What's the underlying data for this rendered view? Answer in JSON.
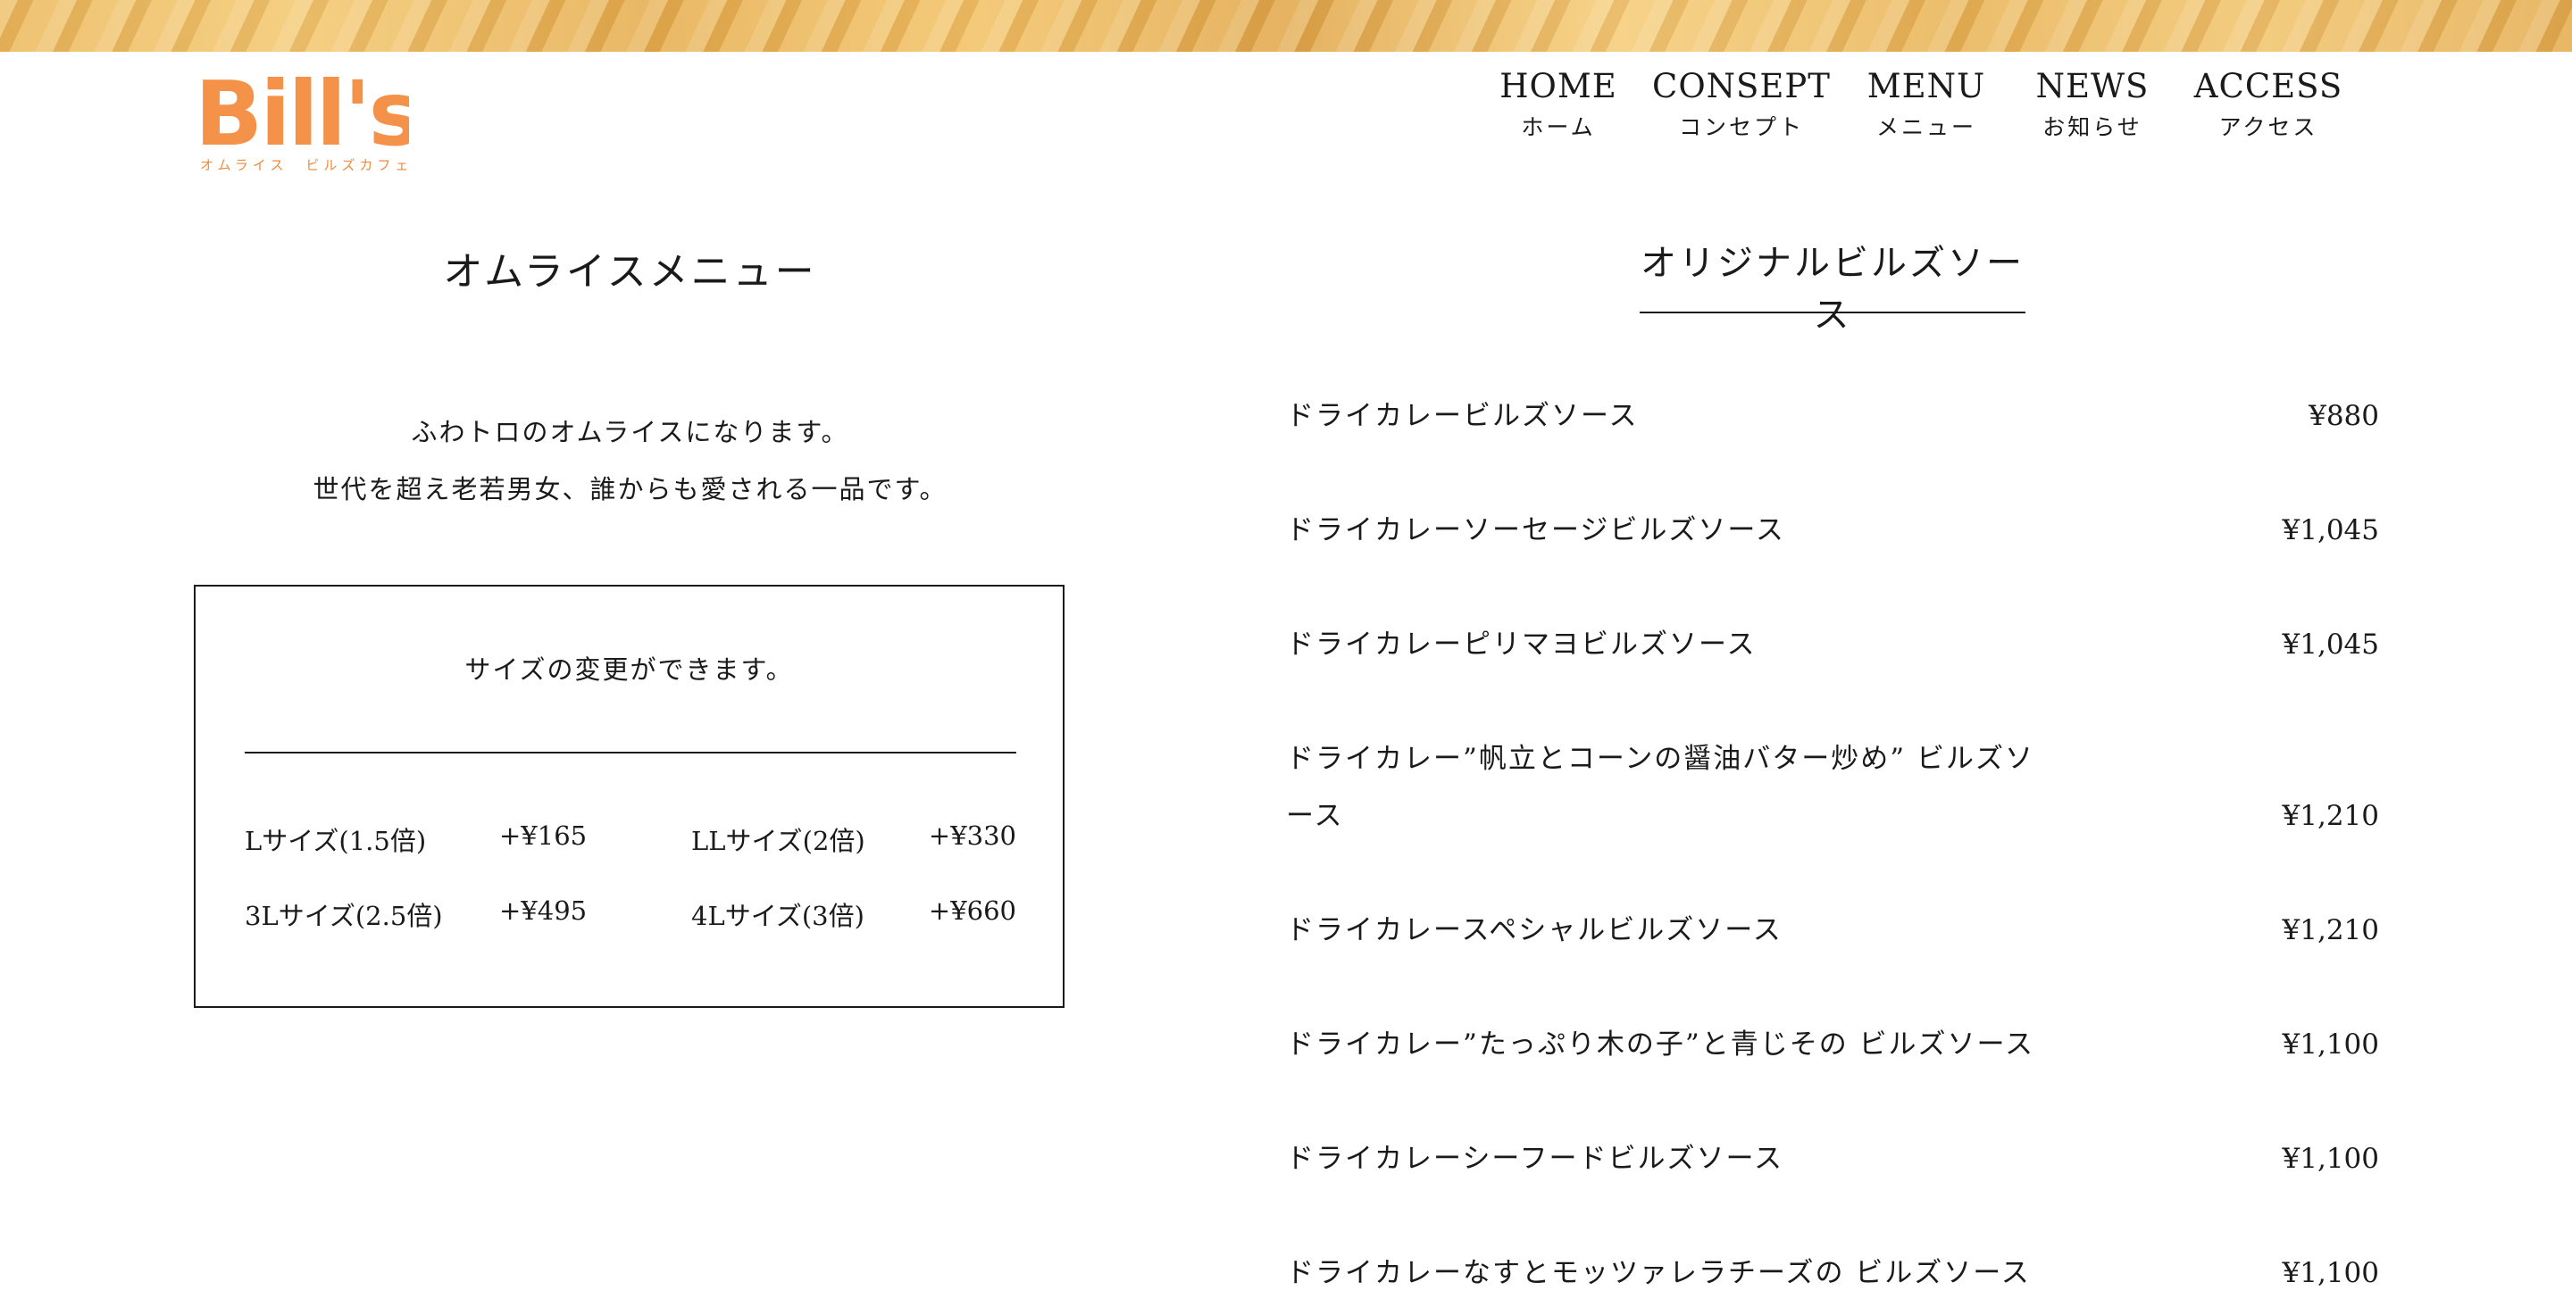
{
  "brand": {
    "logo_text": "Bill's",
    "logo_sub": "オムライス　ビルズカフェ",
    "color": "#f5924a"
  },
  "nav": [
    {
      "en": "HOME",
      "jp": "ホーム"
    },
    {
      "en": "CONSEPT",
      "jp": "コンセプト"
    },
    {
      "en": "MENU",
      "jp": "メニュー"
    },
    {
      "en": "NEWS",
      "jp": "お知らせ"
    },
    {
      "en": "ACCESS",
      "jp": "アクセス"
    }
  ],
  "left": {
    "title": "オムライスメニュー",
    "intro_line1": "ふわトロのオムライスになります。",
    "intro_line2": "世代を超え老若男女、誰からも愛される一品です。",
    "size_box": {
      "title": "サイズの変更ができます。",
      "options": [
        {
          "label": "Lサイズ(1.5倍)",
          "price": "+¥165"
        },
        {
          "label": "LLサイズ(2倍)",
          "price": "+¥330"
        },
        {
          "label": "3Lサイズ(2.5倍)",
          "price": "+¥495"
        },
        {
          "label": "4Lサイズ(3倍)",
          "price": "+¥660"
        }
      ]
    }
  },
  "right": {
    "title": "オリジナルビルズソース",
    "items": [
      {
        "name": "ドライカレービルズソース",
        "price": "¥880"
      },
      {
        "name": "ドライカレーソーセージビルズソース",
        "price": "¥1,045"
      },
      {
        "name": "ドライカレーピリマヨビルズソース",
        "price": "¥1,045"
      },
      {
        "name": "ドライカレー”帆立とコーンの醤油バター炒め” ビルズソース",
        "price": "¥1,210"
      },
      {
        "name": "ドライカレースペシャルビルズソース",
        "price": "¥1,210"
      },
      {
        "name": "ドライカレー”たっぷり木の子”と青じその ビルズソース",
        "price": "¥1,100"
      },
      {
        "name": "ドライカレーシーフードビルズソース",
        "price": "¥1,100"
      },
      {
        "name": "ドライカレーなすとモッツァレラチーズの ビルズソース",
        "price": "¥1,100"
      }
    ]
  }
}
